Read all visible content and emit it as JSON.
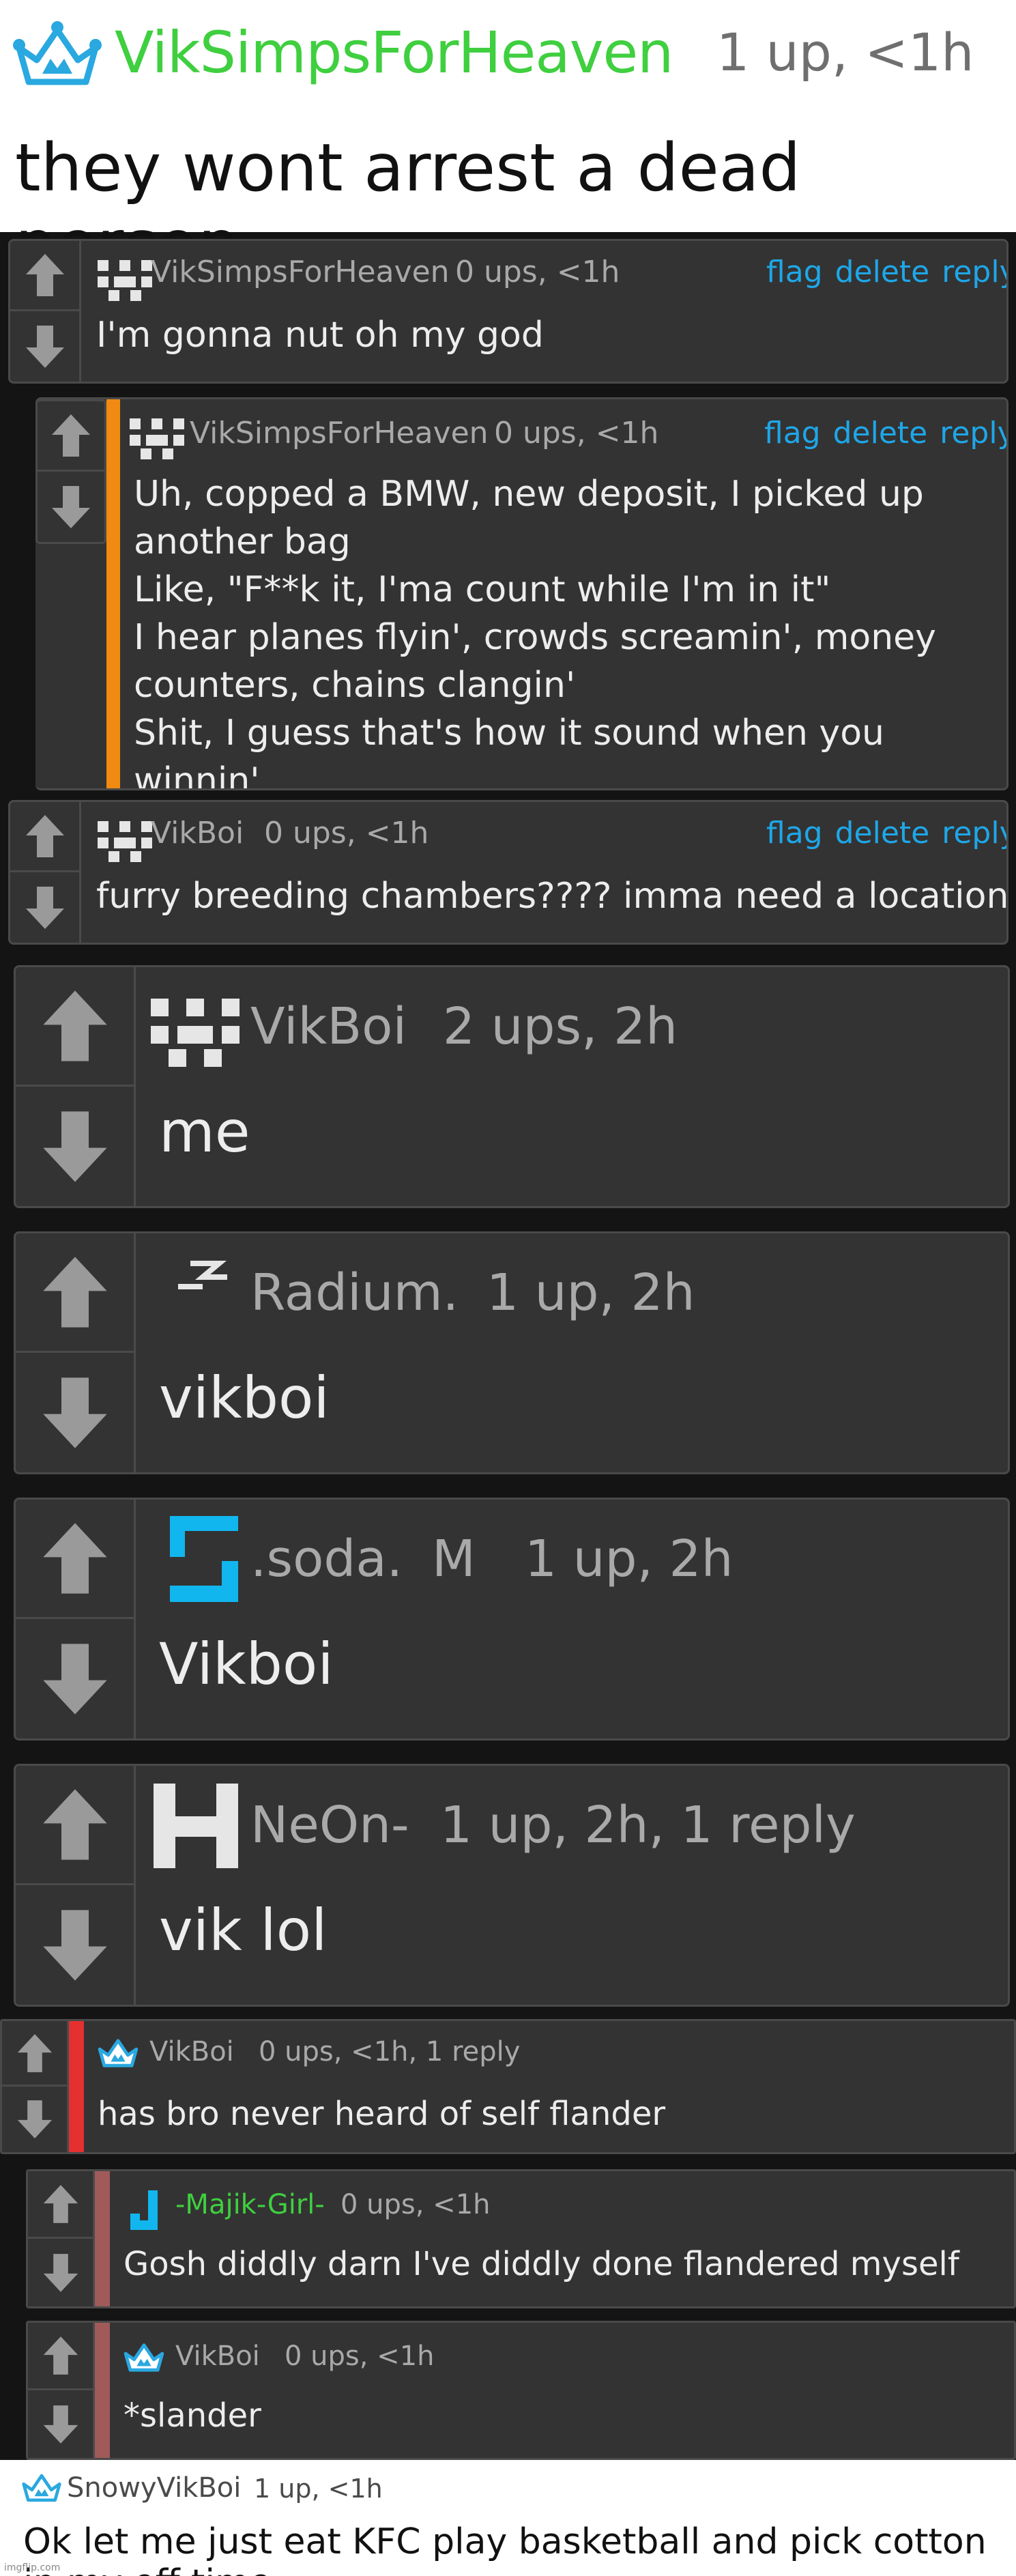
{
  "header": {
    "author": "VikSimpsForHeaven",
    "meta": "1 up, <1h",
    "title": "they wont arrest a dead person"
  },
  "actions": {
    "flag": "flag",
    "delete": "delete",
    "reply": "reply"
  },
  "comments": [
    {
      "user": "VikSimpsForHeaven",
      "meta": "0 ups, <1h",
      "text": "I'm gonna nut oh my god"
    },
    {
      "user": "VikSimpsForHeaven",
      "meta": "0 ups, <1h",
      "text": "Uh, copped a BMW, new deposit, I picked up another bag\nLike, \"F**k it, I'ma count while I'm in it\"\nI hear planes flyin', crowds screamin', money counters, chains clangin'\nShit, I guess that's how it sound when you winnin'"
    },
    {
      "user": "VikBoi",
      "meta": "0 ups, <1h",
      "text": "furry breeding chambers???? imma need a location"
    },
    {
      "user": "VikBoi",
      "meta": "2 ups, 2h",
      "text": "me"
    },
    {
      "user": "Radium.",
      "meta": "1 up, 2h",
      "text": "vikboi"
    },
    {
      "user": ".soda.",
      "badge": "M",
      "meta": "1 up, 2h",
      "text": "Vikboi"
    },
    {
      "user": "NeOn-",
      "meta": "1 up, 2h, 1 reply",
      "text": "vik lol"
    },
    {
      "user": "VikBoi",
      "meta": "0 ups, <1h, 1 reply",
      "text": "has bro never heard of self flander"
    },
    {
      "user": "-Majik-Girl-",
      "meta": "0 ups, <1h",
      "text": "Gosh diddly darn I've diddly done flandered myself"
    },
    {
      "user": "VikBoi",
      "meta": "0 ups, <1h",
      "text": "*slander"
    }
  ],
  "footer": {
    "user": "SnowyVikBoi",
    "meta": "1 up, <1h",
    "text": "Ok let me just eat KFC play basketball and pick cotton in my off time"
  },
  "watermark": "imgflip.com",
  "colors": {
    "accent_green": "#3fcf3f",
    "link_blue": "#1ea7e8",
    "bar_orange": "#f08a12",
    "bar_red": "#e53030",
    "bar_rose": "#a05a5a",
    "crown_blue": "#2aa8e0"
  }
}
